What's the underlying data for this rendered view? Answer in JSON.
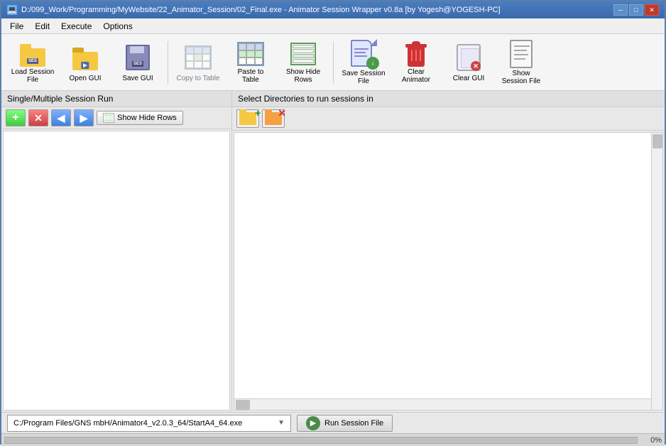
{
  "window": {
    "title": "D:/099_Work/Programming/MyWebsite/22_Animator_Session/02_Final.exe - Animator Session Wrapper v0.8a [by Yogesh@YOGESH-PC]",
    "icon": "💻"
  },
  "menu": {
    "items": [
      "File",
      "Edit",
      "Execute",
      "Options"
    ]
  },
  "toolbar": {
    "buttons": [
      {
        "id": "load-session",
        "label": "Load Session File",
        "icon": "folder-open"
      },
      {
        "id": "open-gui",
        "label": "Open GUI",
        "icon": "folder-open"
      },
      {
        "id": "save-gui",
        "label": "Save GUI",
        "icon": "floppy"
      },
      {
        "id": "copy-to-table",
        "label": "Copy to Table",
        "icon": "table"
      },
      {
        "id": "paste-to-table",
        "label": "Paste to Table",
        "icon": "table-paste"
      },
      {
        "id": "show-hide-rows",
        "label": "Show Hide Rows",
        "icon": "rows"
      },
      {
        "id": "save-session-file",
        "label": "Save Session File",
        "icon": "session-save"
      },
      {
        "id": "clear-animator",
        "label": "Clear Animator",
        "icon": "trash"
      },
      {
        "id": "clear-gui",
        "label": "Clear GUI",
        "icon": "clear-gui"
      },
      {
        "id": "show-session-file",
        "label": "Show Session File",
        "icon": "doc"
      }
    ]
  },
  "left_panel": {
    "header": "Single/Multiple Session Run",
    "buttons": [
      {
        "id": "add",
        "label": "+",
        "title": "Add"
      },
      {
        "id": "remove",
        "label": "✕",
        "title": "Remove"
      },
      {
        "id": "move-left",
        "label": "◀",
        "title": "Move Left"
      },
      {
        "id": "move-right",
        "label": "▶",
        "title": "Move Right"
      }
    ],
    "show_hide_label": "Show Hide Rows",
    "content": []
  },
  "right_panel": {
    "header": "Select Directories to run sessions in",
    "buttons": [
      {
        "id": "add-dir",
        "label": "folder-add",
        "title": "Add Directory"
      },
      {
        "id": "remove-dir",
        "label": "folder-remove",
        "title": "Remove Directory"
      }
    ],
    "content": []
  },
  "status_bar": {
    "exe_path": "C:/Program Files/GNS mbH/Animator4_v2.0.3_64/StartA4_64.exe",
    "run_button_label": "Run Session File",
    "dropdown_arrow": "▼"
  },
  "progress": {
    "value": "0%",
    "percent": 0
  }
}
